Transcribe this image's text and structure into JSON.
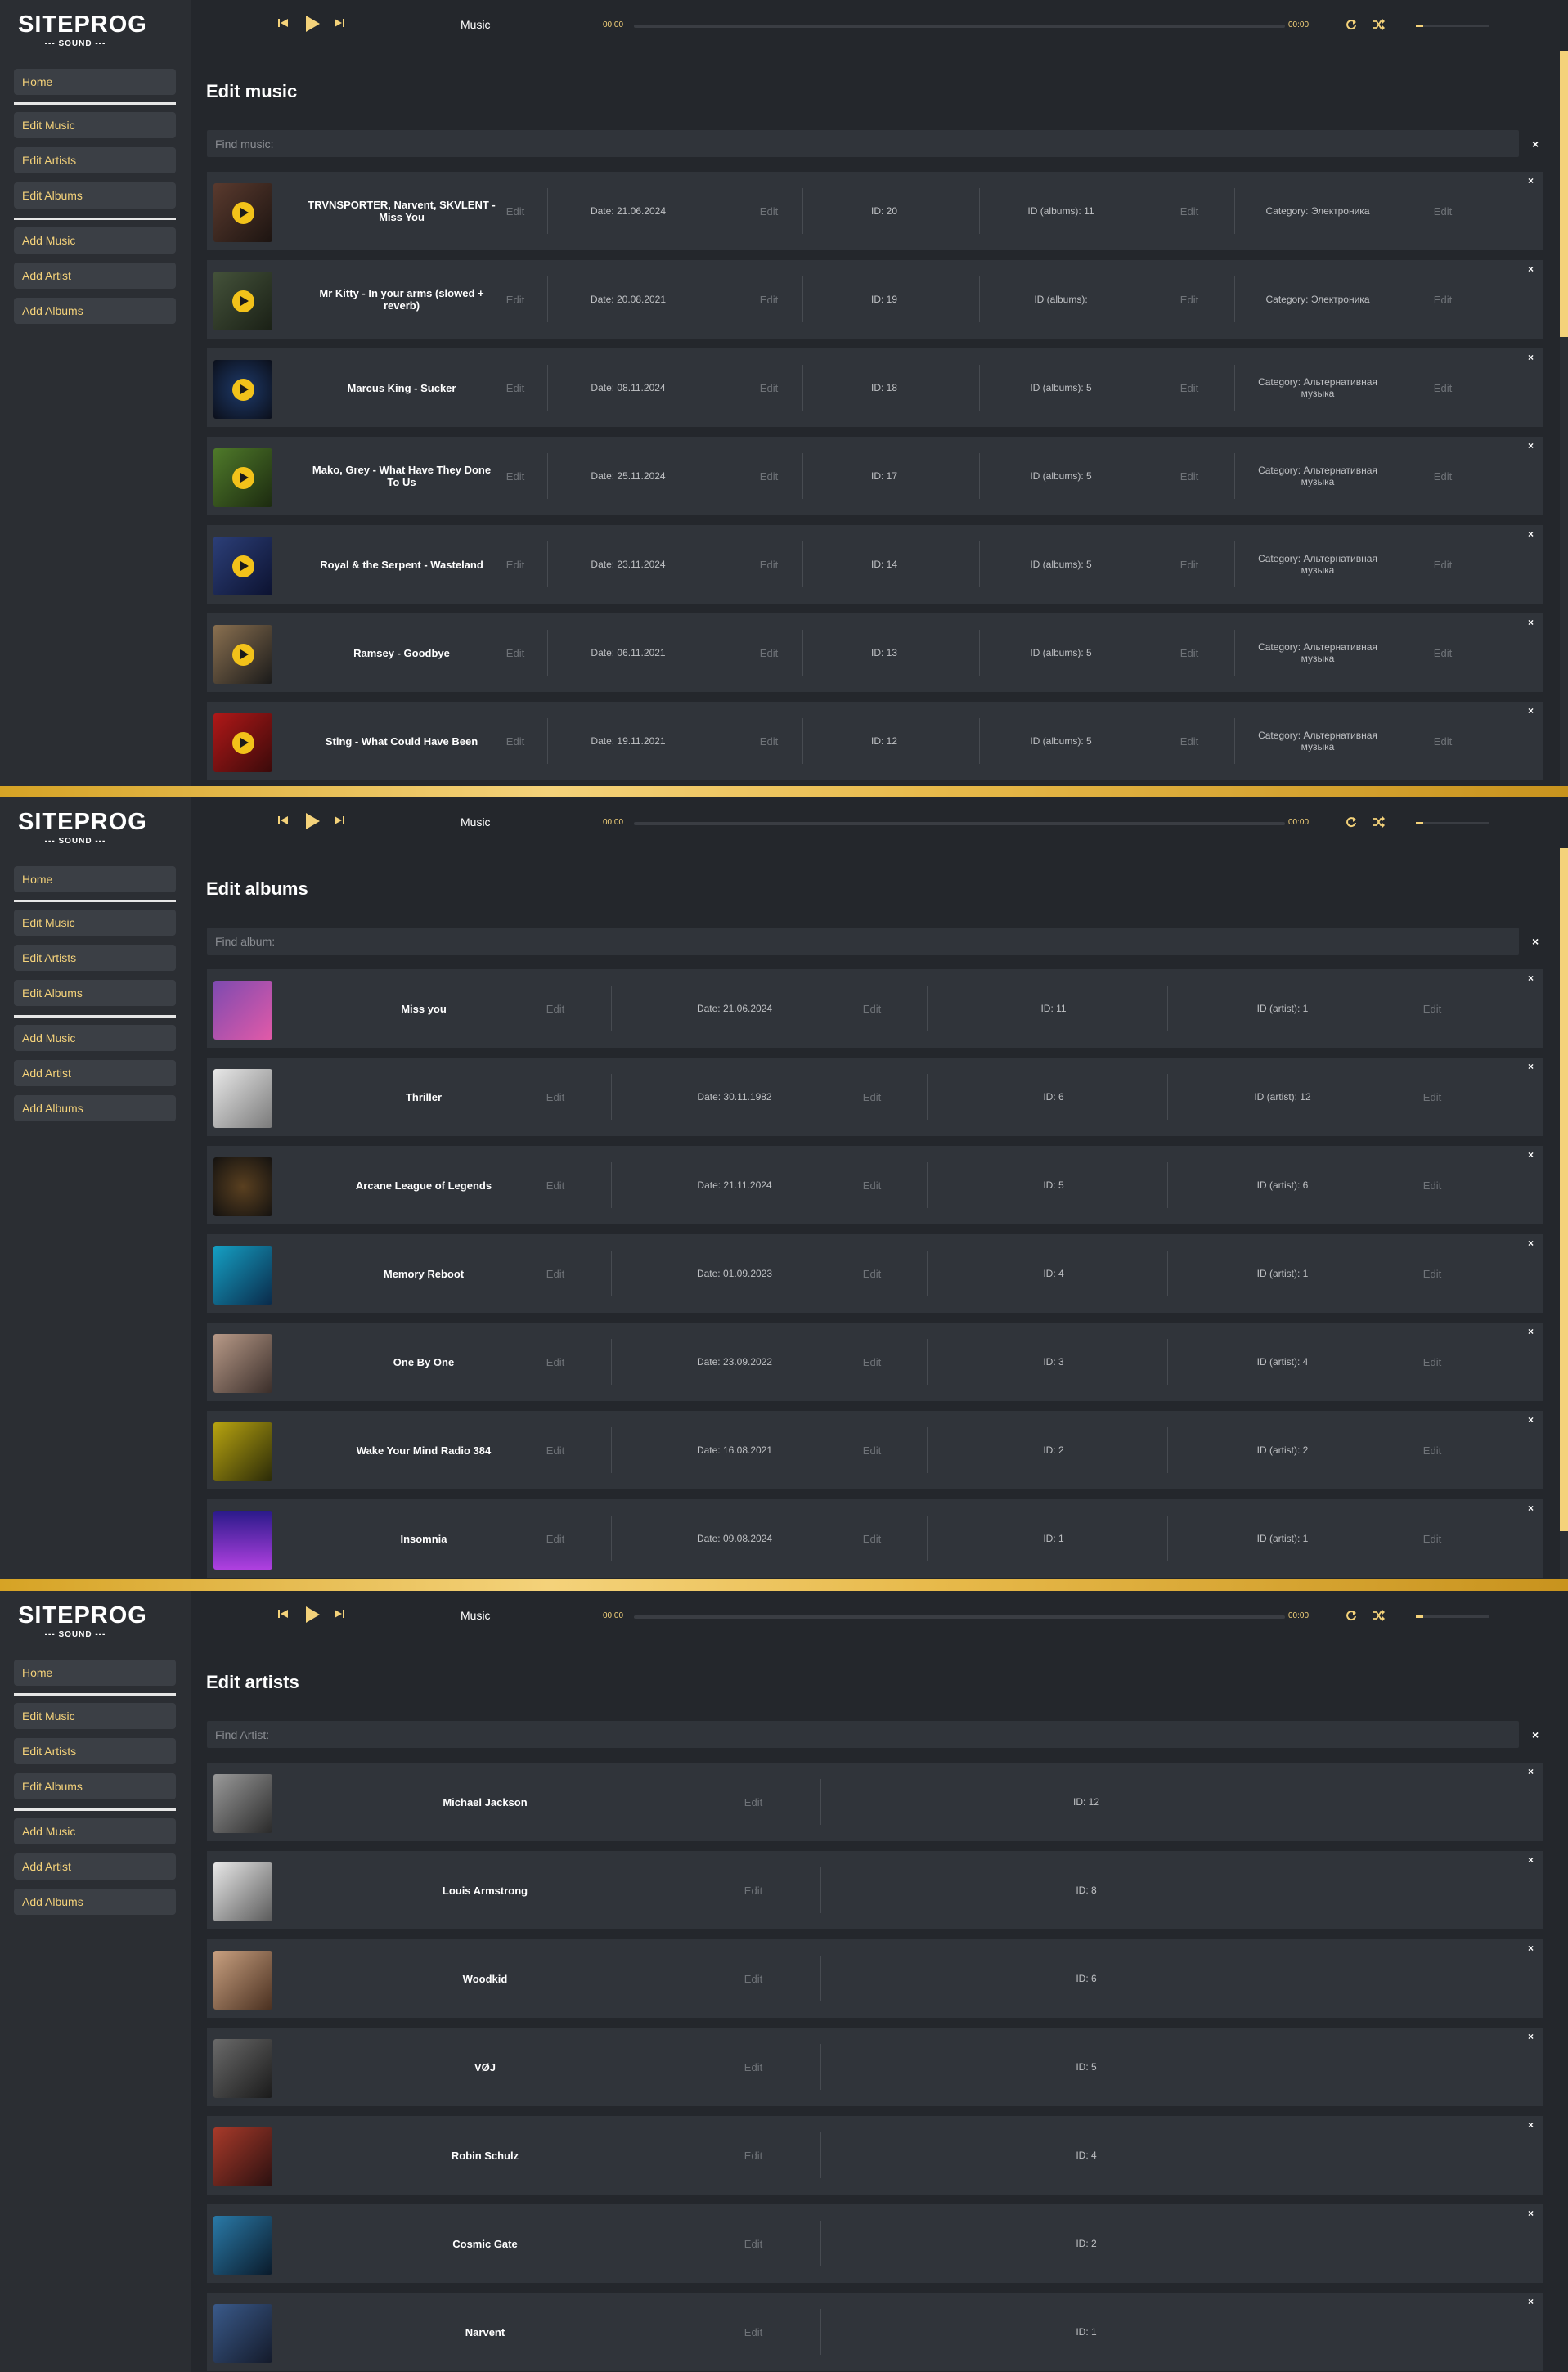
{
  "logo": {
    "main": "SITEPROG",
    "sub": "--- SOUND ---"
  },
  "nav": {
    "home": "Home",
    "edit_music": "Edit Music",
    "edit_artists": "Edit Artists",
    "edit_albums": "Edit Albums",
    "add_music": "Add Music",
    "add_artist": "Add Artist",
    "add_albums": "Add Albums"
  },
  "player": {
    "title": "Music",
    "time_current": "00:00",
    "time_total": "00:00",
    "progress": 0,
    "volume": 0.1
  },
  "colors": {
    "accent": "#f4d27a",
    "play": "#f2c21a",
    "background": "#24272c",
    "row": "#30343a",
    "sidebar": "#2b2e33"
  },
  "icons": [
    "skip-back-icon",
    "play-icon",
    "skip-forward-icon",
    "repeat-icon",
    "shuffle-icon",
    "close-icon",
    "play-circle-icon"
  ],
  "music": {
    "title": "Edit music",
    "search_placeholder": "Find music:",
    "close": "×",
    "edit_label": "Edit",
    "rows": [
      {
        "name": "TRVNSPORTER, Narvent, SKVLENT - Miss You",
        "date": "Date: 21.06.2024",
        "id": "ID: 20",
        "albums": "ID (albums): 11",
        "category": "Category: Электроника"
      },
      {
        "name": "Mr Kitty - In your arms (slowed + reverb)",
        "date": "Date: 20.08.2021",
        "id": "ID: 19",
        "albums": "ID (albums):",
        "category": "Category: Электроника"
      },
      {
        "name": "Marcus King - Sucker",
        "date": "Date: 08.11.2024",
        "id": "ID: 18",
        "albums": "ID (albums): 5",
        "category": "Category: Альтернативная музыка"
      },
      {
        "name": "Mako, Grey - What Have They Done To Us",
        "date": "Date: 25.11.2024",
        "id": "ID: 17",
        "albums": "ID (albums): 5",
        "category": "Category: Альтернативная музыка"
      },
      {
        "name": "Royal & the Serpent - Wasteland",
        "date": "Date: 23.11.2024",
        "id": "ID: 14",
        "albums": "ID (albums): 5",
        "category": "Category: Альтернативная музыка"
      },
      {
        "name": "Ramsey - Goodbye",
        "date": "Date: 06.11.2021",
        "id": "ID: 13",
        "albums": "ID (albums): 5",
        "category": "Category: Альтернативная музыка"
      },
      {
        "name": "Sting - What Could Have Been",
        "date": "Date: 19.11.2021",
        "id": "ID: 12",
        "albums": "ID (albums): 5",
        "category": "Category: Альтернативная музыка"
      }
    ]
  },
  "albums": {
    "title": "Edit albums",
    "search_placeholder": "Find album:",
    "close": "×",
    "edit_label": "Edit",
    "rows": [
      {
        "name": "Miss you",
        "date": "Date: 21.06.2024",
        "id": "ID: 11",
        "artist": "ID (artist): 1"
      },
      {
        "name": "Thriller",
        "date": "Date: 30.11.1982",
        "id": "ID: 6",
        "artist": "ID (artist): 12"
      },
      {
        "name": "Arcane League of Legends",
        "date": "Date: 21.11.2024",
        "id": "ID: 5",
        "artist": "ID (artist): 6"
      },
      {
        "name": "Memory Reboot",
        "date": "Date: 01.09.2023",
        "id": "ID: 4",
        "artist": "ID (artist): 1"
      },
      {
        "name": "One By One",
        "date": "Date: 23.09.2022",
        "id": "ID: 3",
        "artist": "ID (artist): 4"
      },
      {
        "name": "Wake Your Mind Radio 384",
        "date": "Date: 16.08.2021",
        "id": "ID: 2",
        "artist": "ID (artist): 2"
      },
      {
        "name": "Insomnia",
        "date": "Date: 09.08.2024",
        "id": "ID: 1",
        "artist": "ID (artist): 1"
      }
    ]
  },
  "artists": {
    "title": "Edit artists",
    "search_placeholder": "Find Artist:",
    "close": "×",
    "edit_label": "Edit",
    "rows": [
      {
        "name": "Michael Jackson",
        "id": "ID: 12"
      },
      {
        "name": "Louis Armstrong",
        "id": "ID: 8"
      },
      {
        "name": "Woodkid",
        "id": "ID: 6"
      },
      {
        "name": "VØJ",
        "id": "ID: 5"
      },
      {
        "name": "Robin Schulz",
        "id": "ID: 4"
      },
      {
        "name": "Cosmic Gate",
        "id": "ID: 2"
      },
      {
        "name": "Narvent",
        "id": "ID: 1"
      }
    ]
  }
}
